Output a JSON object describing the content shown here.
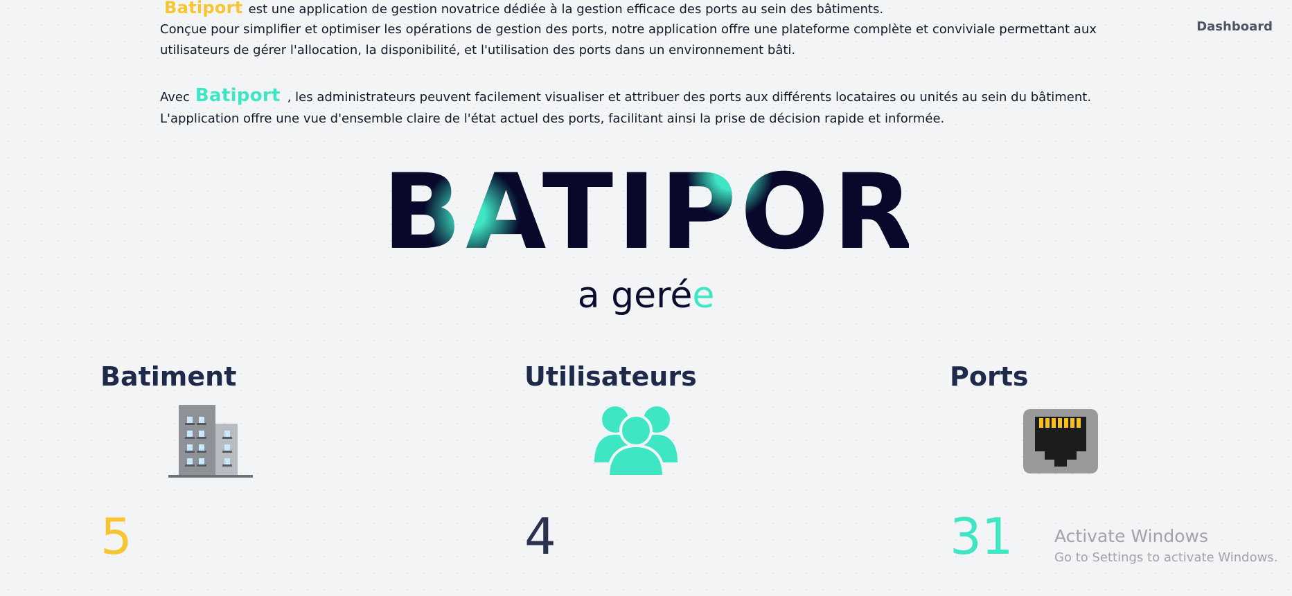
{
  "nav": {
    "dashboard": "Dashboard"
  },
  "intro": {
    "brand": "Batiport",
    "p1_rest": "est une application de gestion novatrice dédiée à la gestion efficace des ports au sein des bâtiments.",
    "p2": "Conçue pour simplifier et optimiser les opérations de gestion des ports, notre application offre une plateforme complète et conviviale permettant aux utilisateurs de gérer l'allocation, la disponibilité, et l'utilisation des ports dans un environnement bâti.",
    "p3_lead": "Avec",
    "p3_rest": ", les administrateurs peuvent facilement visualiser et attribuer des ports aux différents locataires ou unités au sein du bâtiment.",
    "p4": "L'application offre une vue d'ensemble claire de l'état actuel des ports, facilitant ainsi la prise de décision rapide et informée."
  },
  "hero": {
    "title": "BATIPORT",
    "sub_main": "a geré",
    "sub_accent": "e"
  },
  "stats": [
    {
      "label": "Batiment",
      "value": "5",
      "icon": "building-icon",
      "color": "#f7c531"
    },
    {
      "label": "Utilisateurs",
      "value": "4",
      "icon": "users-icon",
      "color": "#2b3250"
    },
    {
      "label": "Ports",
      "value": "31",
      "icon": "ethernet-port-icon",
      "color": "#3ee6c3"
    }
  ],
  "watermark": {
    "line1": "Activate Windows",
    "line2": "Go to Settings to activate Windows."
  }
}
